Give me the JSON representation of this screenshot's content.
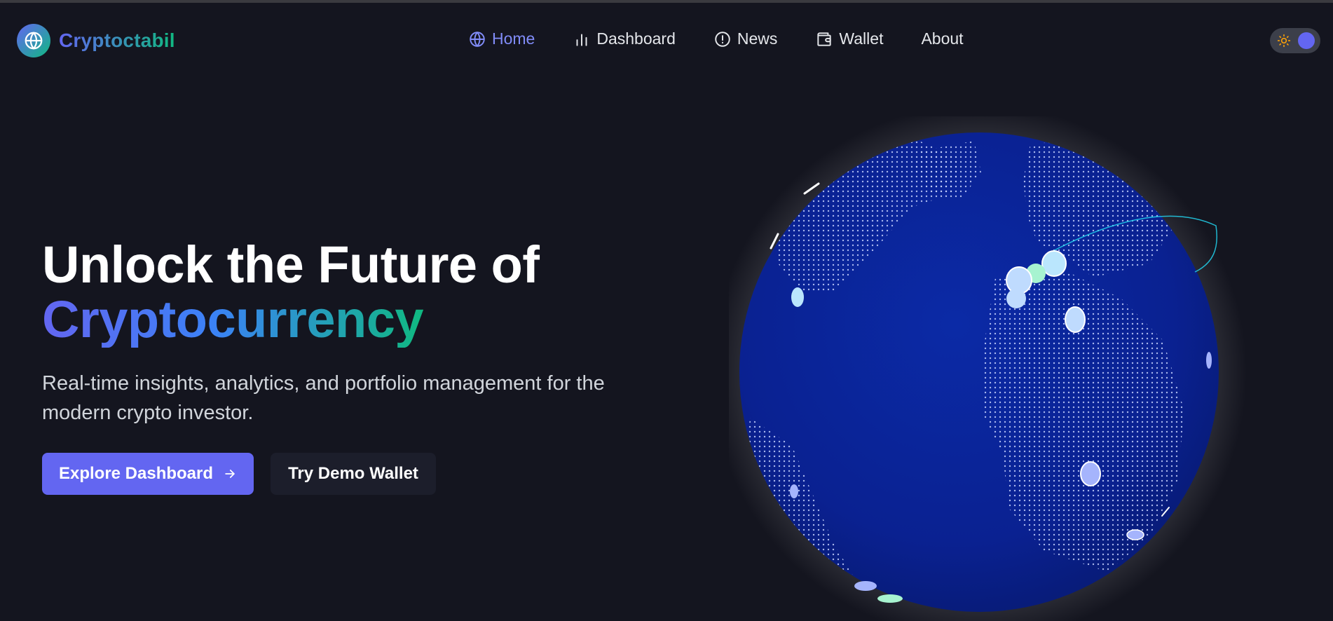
{
  "brand": {
    "name": "Cryptoctabil",
    "logo_icon": "globe-icon"
  },
  "nav": {
    "items": [
      {
        "label": "Home",
        "icon": "globe-icon",
        "active": true
      },
      {
        "label": "Dashboard",
        "icon": "bar-chart-icon",
        "active": false
      },
      {
        "label": "News",
        "icon": "alert-circle-icon",
        "active": false
      },
      {
        "label": "Wallet",
        "icon": "wallet-icon",
        "active": false
      },
      {
        "label": "About",
        "icon": "",
        "active": false
      }
    ]
  },
  "theme_toggle": {
    "icon": "sun-icon",
    "state": "dark"
  },
  "hero": {
    "title_line1": "Unlock the Future of",
    "title_line2": "Cryptocurrency",
    "subtitle": "Real-time insights, analytics, and portfolio management for the modern crypto investor.",
    "primary_button": "Explore Dashboard",
    "secondary_button": "Try Demo Wallet"
  },
  "colors": {
    "background": "#14151f",
    "accent": "#6366f1",
    "accent_green": "#10b981",
    "active_nav": "#818cf8",
    "globe": "#0a2191"
  }
}
